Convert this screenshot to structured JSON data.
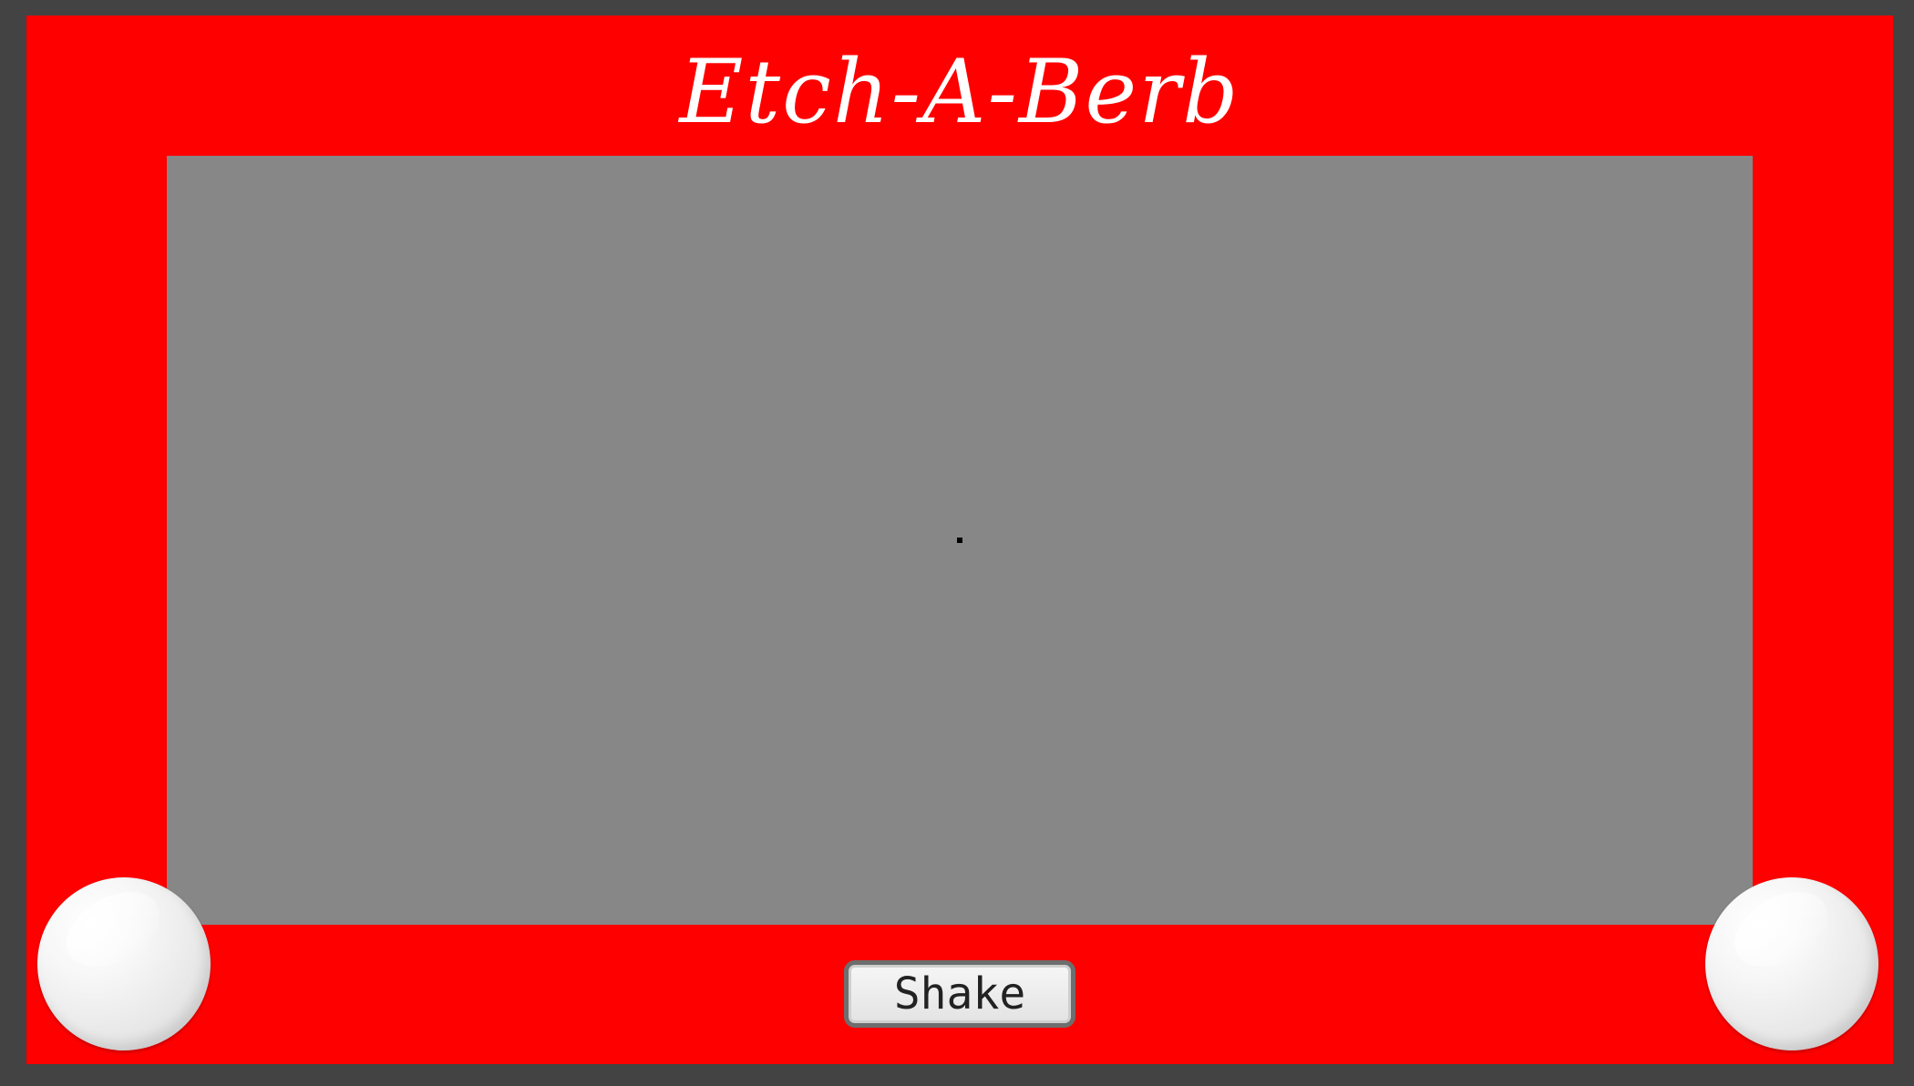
{
  "app": {
    "title": "Etch-A-Berb"
  },
  "controls": {
    "shake_label": "Shake"
  },
  "icons": {
    "left_knob": "knob-icon",
    "right_knob": "knob-icon"
  },
  "colors": {
    "frame": "#fe0000",
    "screen": "#878787",
    "background": "#434343",
    "title_text": "#ffffff",
    "cursor": "#000000"
  }
}
